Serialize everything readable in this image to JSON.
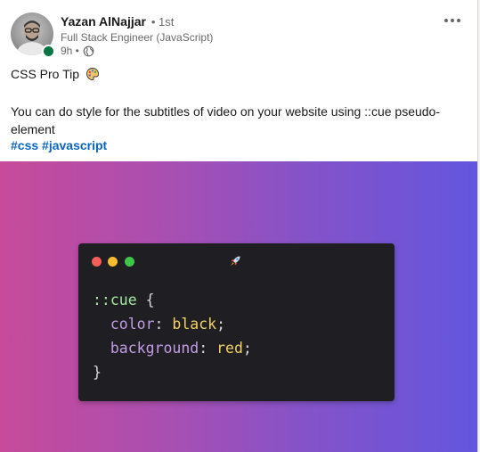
{
  "post": {
    "author": {
      "name": "Yazan AlNajjar",
      "degree": "• 1st",
      "headline": "Full Stack Engineer (JavaScript)",
      "time": "9h •",
      "visibility_icon": "globe-icon"
    },
    "menu_icon": "more-horizontal-icon",
    "text_line1": "CSS Pro Tip",
    "text_emoji": "palette-emoji",
    "text_body": "You can do style for the subtitles of video on your website using ::cue pseudo-element",
    "hashtags": [
      "#css",
      "#javascript"
    ]
  },
  "media": {
    "window_dots": [
      "red",
      "yellow",
      "green"
    ],
    "rocket_icon": "rocket-emoji",
    "code": {
      "selector": "::cue",
      "open_brace": " {",
      "props": [
        {
          "name": "color",
          "value": "black"
        },
        {
          "name": "background",
          "value": "red"
        }
      ],
      "close_brace": "}"
    }
  },
  "colors": {
    "hashtag": "#0a66c2",
    "online": "#057642",
    "gradient_start": "#c74b99",
    "gradient_end": "#6356dd",
    "code_bg": "#1f1e22"
  }
}
